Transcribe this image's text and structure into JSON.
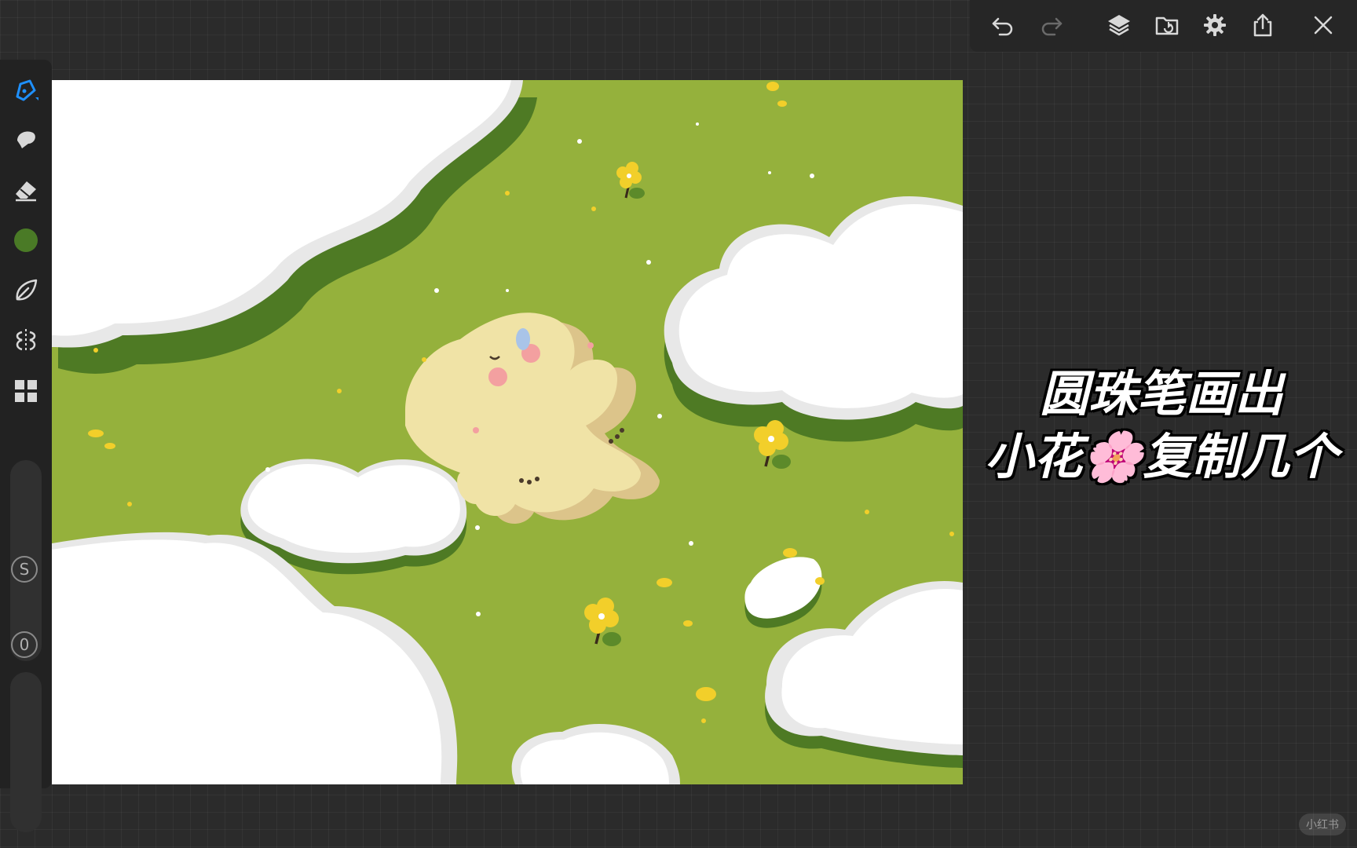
{
  "toolbar": {
    "icons": [
      "undo-icon",
      "redo-icon",
      "layers-icon",
      "import-icon",
      "gear-icon",
      "share-icon",
      "close-icon"
    ]
  },
  "left_tools": {
    "icons": [
      "pen-icon",
      "smudge-icon",
      "eraser-icon",
      "color-swatch",
      "leaf-brush-icon",
      "symmetry-icon",
      "grid-icon"
    ],
    "active_color": "#4a7a26",
    "accent": "#1e90ff",
    "stabilizer_label": "S",
    "opacity_label": "0"
  },
  "caption": {
    "line1": "圆珠笔画出",
    "line2": "小花🌸复制几个"
  },
  "watermark": "小红书",
  "colors": {
    "grass": "#95b13c",
    "grass_shadow": "#4e7a24",
    "cloud": "#ffffff",
    "cloud_shade": "#e6e6e6",
    "flower": "#f2cf2a",
    "creature": "#f0e3a6"
  }
}
